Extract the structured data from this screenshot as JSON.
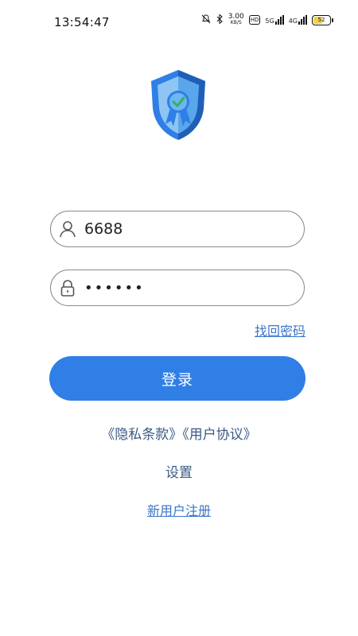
{
  "status_bar": {
    "time": "13:54:47",
    "speed_value": "3.00",
    "speed_unit": "KB/S",
    "hd_label": "HD",
    "signal1_label": "5G",
    "signal2_label": "4G",
    "battery_level": "52"
  },
  "login_form": {
    "username_value": "6688",
    "password_value": "••••••",
    "forgot_password_label": "找回密码",
    "login_button_label": "登录"
  },
  "links": {
    "privacy_label": "《隐私条款》",
    "agreement_label": "《用户协议》",
    "settings_label": "设置",
    "register_label": "新用户注册"
  },
  "colors": {
    "primary": "#2f7fe6",
    "link": "#3a76c9",
    "field_border": "#8a8a8a"
  },
  "icons": {
    "username": "user-icon",
    "password": "lock-icon",
    "logo": "shield-badge-icon"
  }
}
